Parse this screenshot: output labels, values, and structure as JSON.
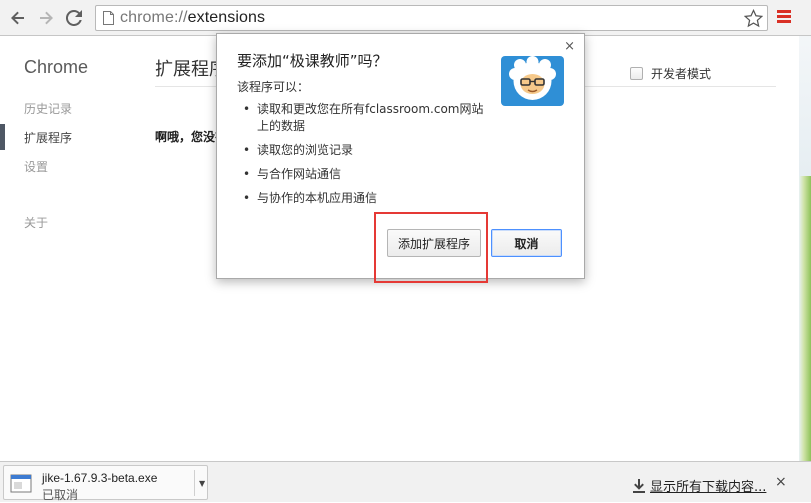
{
  "browser": {
    "url_scheme": "chrome://",
    "url_host": "extensions",
    "accent_color": "#d93025"
  },
  "sidebar": {
    "brand": "Chrome",
    "items": [
      {
        "label": "历史记录",
        "active": false
      },
      {
        "label": "扩展程序",
        "active": true
      },
      {
        "label": "设置",
        "active": false
      },
      {
        "label": "关于",
        "active": false
      }
    ]
  },
  "main": {
    "title": "扩展程序",
    "developer_mode_label": "开发者模式",
    "developer_mode_checked": false,
    "empty_message": "啊哦，您没有安装扩展程序"
  },
  "dialog": {
    "title": "要添加“极课教师”吗？",
    "subtitle": "该程序可以：",
    "permissions": [
      "读取和更改您在所有fclassroom.com网站上的数据",
      "读取您的浏览记录",
      "与合作网站通信",
      "与协作的本机应用通信"
    ],
    "add_button": "添加扩展程序",
    "cancel_button": "取消",
    "close_glyph": "×",
    "highlight_color": "#e53935"
  },
  "downloads": {
    "file_name": "jike-1.67.9.3-beta.exe",
    "status": "已取消",
    "show_all": "显示所有下载内容...",
    "close_glyph": "×"
  }
}
